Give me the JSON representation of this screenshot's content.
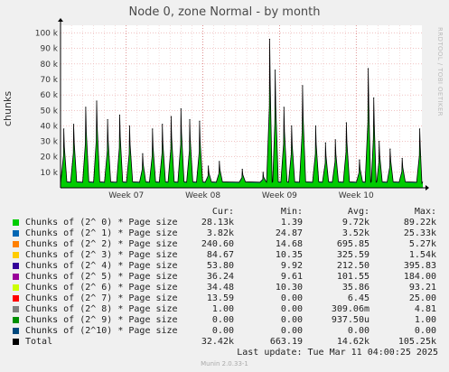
{
  "title": "Node 0, zone Normal - by month",
  "ylabel": "chunks",
  "sidebar_text": "RRDTOOL / TOBI OETIKER",
  "footer": {
    "last_update": "Last update: Tue Mar 11 04:00:25 2025",
    "version": "Munin 2.0.33-1"
  },
  "legend": {
    "headers": {
      "cur": "Cur:",
      "min": "Min:",
      "avg": "Avg:",
      "max": "Max:"
    },
    "rows": [
      {
        "label": "Chunks of (2^ 0) * Page size",
        "color": "#00cc00",
        "cur": "28.13k",
        "min": "1.39",
        "avg": "9.72k",
        "max": "89.22k"
      },
      {
        "label": "Chunks of (2^ 1) * Page size",
        "color": "#0066b3",
        "cur": "3.82k",
        "min": "24.87",
        "avg": "3.52k",
        "max": "25.33k"
      },
      {
        "label": "Chunks of (2^ 2) * Page size",
        "color": "#ff8000",
        "cur": "240.60",
        "min": "14.68",
        "avg": "695.85",
        "max": "5.27k"
      },
      {
        "label": "Chunks of (2^ 3) * Page size",
        "color": "#ffcc00",
        "cur": "84.67",
        "min": "10.35",
        "avg": "325.59",
        "max": "1.54k"
      },
      {
        "label": "Chunks of (2^ 4) * Page size",
        "color": "#330099",
        "cur": "53.80",
        "min": "9.92",
        "avg": "212.50",
        "max": "395.83"
      },
      {
        "label": "Chunks of (2^ 5) * Page size",
        "color": "#990099",
        "cur": "36.24",
        "min": "9.61",
        "avg": "101.55",
        "max": "184.00"
      },
      {
        "label": "Chunks of (2^ 6) * Page size",
        "color": "#ccff00",
        "cur": "34.48",
        "min": "10.30",
        "avg": "35.86",
        "max": "93.21"
      },
      {
        "label": "Chunks of (2^ 7) * Page size",
        "color": "#ff0000",
        "cur": "13.59",
        "min": "0.00",
        "avg": "6.45",
        "max": "25.00"
      },
      {
        "label": "Chunks of (2^ 8) * Page size",
        "color": "#808080",
        "cur": "1.00",
        "min": "0.00",
        "avg": "309.06m",
        "max": "4.81"
      },
      {
        "label": "Chunks of (2^ 9) * Page size",
        "color": "#008f00",
        "cur": "0.00",
        "min": "0.00",
        "avg": "937.50u",
        "max": "1.00"
      },
      {
        "label": "Chunks of (2^10) * Page size",
        "color": "#00487d",
        "cur": "0.00",
        "min": "0.00",
        "avg": "0.00",
        "max": "0.00"
      },
      {
        "label": "Total",
        "color": "#000000",
        "cur": "32.42k",
        "min": "663.19",
        "avg": "14.62k",
        "max": "105.25k"
      }
    ]
  },
  "chart_data": {
    "type": "area",
    "title": "Node 0, zone Normal - by month",
    "ylabel": "chunks",
    "ylim": [
      0,
      105000
    ],
    "y_ticks": [
      10000,
      20000,
      30000,
      40000,
      50000,
      60000,
      70000,
      80000,
      90000,
      100000
    ],
    "y_tick_labels": [
      "10 k",
      "20 k",
      "30 k",
      "40 k",
      "50 k",
      "60 k",
      "70 k",
      "80 k",
      "90 k",
      "100 k"
    ],
    "x_range": [
      0,
      33
    ],
    "x_ticks": [
      {
        "label": "Week 07",
        "x": 6
      },
      {
        "label": "Week 08",
        "x": 13
      },
      {
        "label": "Week 09",
        "x": 20
      },
      {
        "label": "Week 10",
        "x": 27
      }
    ],
    "grid": true,
    "peaks": [
      {
        "x": 0.3,
        "y": 38000
      },
      {
        "x": 1.2,
        "y": 41000
      },
      {
        "x": 2.3,
        "y": 52000
      },
      {
        "x": 3.3,
        "y": 56000
      },
      {
        "x": 4.3,
        "y": 44000
      },
      {
        "x": 5.4,
        "y": 47000
      },
      {
        "x": 6.3,
        "y": 40000
      },
      {
        "x": 7.5,
        "y": 22000
      },
      {
        "x": 8.4,
        "y": 38000
      },
      {
        "x": 9.3,
        "y": 41000
      },
      {
        "x": 10.1,
        "y": 46000
      },
      {
        "x": 11.0,
        "y": 51000
      },
      {
        "x": 11.8,
        "y": 44000
      },
      {
        "x": 12.7,
        "y": 43000
      },
      {
        "x": 13.5,
        "y": 14000
      },
      {
        "x": 14.5,
        "y": 17000
      },
      {
        "x": 16.6,
        "y": 12000
      },
      {
        "x": 18.5,
        "y": 10000
      },
      {
        "x": 19.1,
        "y": 96000
      },
      {
        "x": 19.6,
        "y": 76000
      },
      {
        "x": 20.4,
        "y": 52000
      },
      {
        "x": 21.1,
        "y": 40000
      },
      {
        "x": 22.1,
        "y": 66000
      },
      {
        "x": 23.3,
        "y": 40000
      },
      {
        "x": 24.2,
        "y": 29000
      },
      {
        "x": 25.1,
        "y": 31000
      },
      {
        "x": 26.1,
        "y": 42000
      },
      {
        "x": 27.3,
        "y": 18000
      },
      {
        "x": 28.1,
        "y": 77000
      },
      {
        "x": 28.6,
        "y": 58000
      },
      {
        "x": 29.1,
        "y": 30000
      },
      {
        "x": 30.1,
        "y": 25000
      },
      {
        "x": 31.2,
        "y": 19000
      },
      {
        "x": 32.8,
        "y": 38000
      }
    ],
    "baseline": 3000
  }
}
